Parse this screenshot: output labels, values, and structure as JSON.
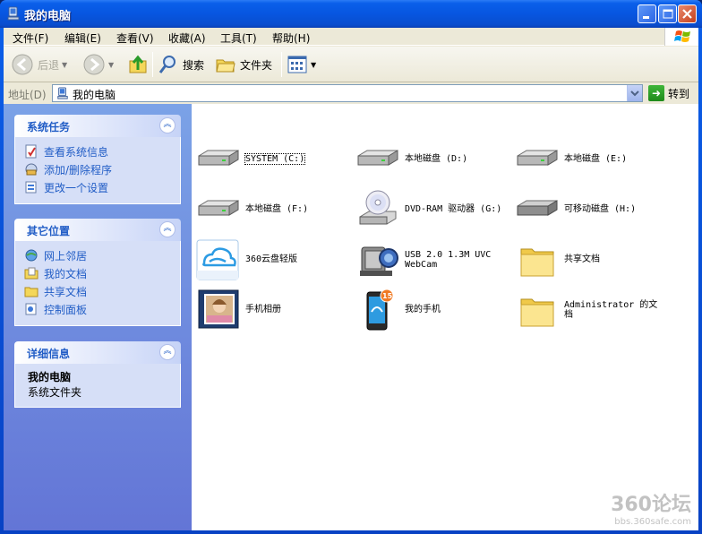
{
  "window": {
    "title": "我的电脑"
  },
  "menu": [
    "文件(F)",
    "编辑(E)",
    "查看(V)",
    "收藏(A)",
    "工具(T)",
    "帮助(H)"
  ],
  "toolbar": {
    "back_label": "后退",
    "search_label": "搜索",
    "folders_label": "文件夹"
  },
  "address": {
    "label": "地址(D)",
    "value": "我的电脑",
    "go_label": "转到"
  },
  "taskpane": {
    "system_tasks": {
      "title": "系统任务",
      "items": [
        "查看系统信息",
        "添加/删除程序",
        "更改一个设置"
      ]
    },
    "other_places": {
      "title": "其它位置",
      "items": [
        "网上邻居",
        "我的文档",
        "共享文档",
        "控制面板"
      ]
    },
    "details": {
      "title": "详细信息",
      "name": "我的电脑",
      "type": "系统文件夹"
    }
  },
  "content": {
    "items": [
      {
        "label": "SYSTEM (C:)",
        "icon": "hard-disk-icon"
      },
      {
        "label": "本地磁盘 (D:)",
        "icon": "hard-disk-icon"
      },
      {
        "label": "本地磁盘 (E:)",
        "icon": "hard-disk-icon"
      },
      {
        "label": "本地磁盘 (F:)",
        "icon": "hard-disk-icon"
      },
      {
        "label": "DVD-RAM 驱动器 (G:)",
        "icon": "dvd-drive-icon"
      },
      {
        "label": "可移动磁盘 (H:)",
        "icon": "removable-disk-icon"
      },
      {
        "label": "360云盘轻版",
        "icon": "cloud-drive-icon"
      },
      {
        "label": "USB 2.0 1.3M UVC",
        "label2": "WebCam",
        "icon": "webcam-icon"
      },
      {
        "label": "共享文档",
        "icon": "folder-icon"
      },
      {
        "label": "手机相册",
        "icon": "photo-album-icon"
      },
      {
        "label": "我的手机",
        "icon": "phone-icon",
        "badge": "15"
      },
      {
        "label": "Administrator 的文",
        "label2": "档",
        "icon": "folder-icon"
      }
    ]
  },
  "watermark": {
    "big": "360论坛",
    "small": "bbs.360safe.com"
  }
}
